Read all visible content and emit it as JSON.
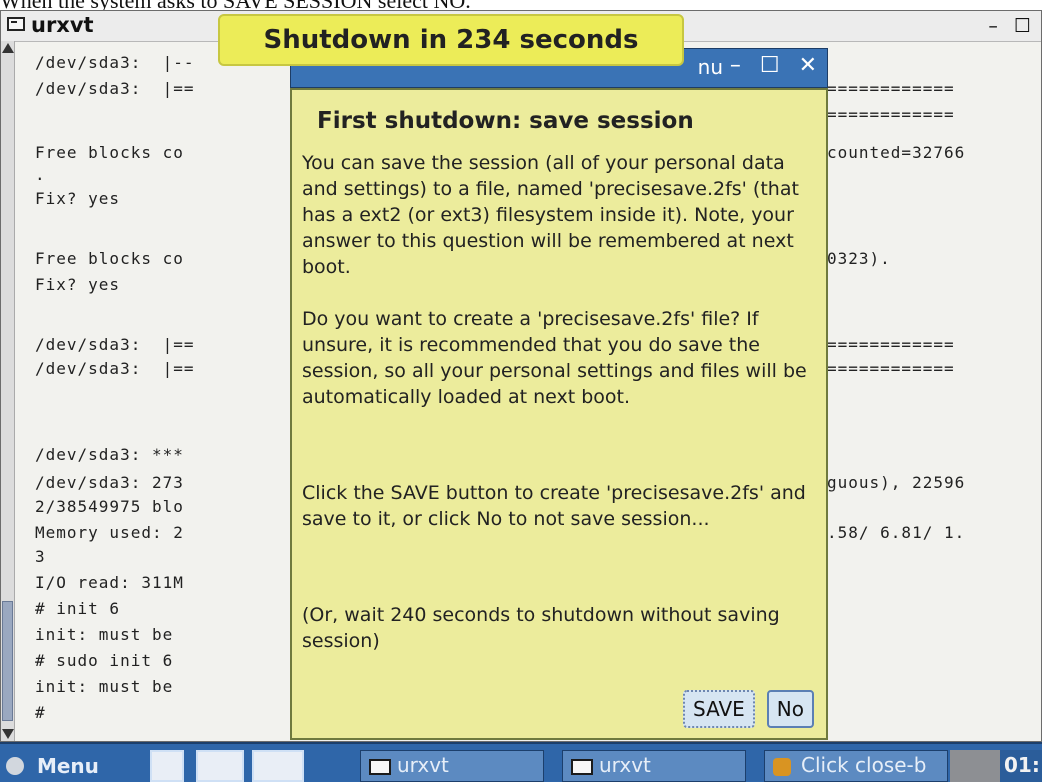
{
  "caption": "When the system asks to SAVE SESSION select NO.",
  "terminal": {
    "title": "urxvt",
    "controls": {
      "minimize": "–",
      "maximize": "☐"
    },
    "lines": [
      "/dev/sda3:  |--",
      "/dev/sda3:  |==",
      "",
      "Free blocks co",
      ".",
      "Fix? yes",
      "",
      "Free blocks co",
      "Fix? yes",
      "",
      "/dev/sda3:  |==",
      "/dev/sda3:  |==",
      "",
      "",
      "/dev/sda3: ***",
      "/dev/sda3: 273",
      "2/38549975 blo",
      "Memory used: 2",
      "3",
      "I/O read: 311M",
      "# init 6",
      "init: must be",
      "# sudo init 6",
      "init: must be",
      "#"
    ],
    "right_fragments": [
      "============",
      "============",
      "",
      "counted=32766",
      "",
      "",
      "",
      "0323).",
      "",
      "",
      "============",
      "============",
      "",
      "",
      "",
      "guous), 22596",
      "",
      ".58/ 6.81/ 1.",
      "",
      "",
      "",
      "",
      "",
      "",
      ""
    ]
  },
  "countdown": "Shutdown in 234 seconds",
  "dialog": {
    "titlebar": {
      "title_fragment": "nu",
      "controls": {
        "minimize": "–",
        "maximize": "☐",
        "close": "✕"
      }
    },
    "heading": "First shutdown: save session",
    "paragraphs": [
      "You can save the session (all of your personal data and settings) to a file, named 'precisesave.2fs' (that has a ext2 (or ext3) filesystem inside it). Note, your answer to this question will be remembered at next boot.",
      "Do you want to create a 'precisesave.2fs' file? If unsure, it is recommended that you do save the session, so all your personal settings and files will be automatically loaded at next boot.",
      "Click the SAVE button to create 'precisesave.2fs' and save to it, or click No to not save session...",
      "(Or, wait 240 seconds to shutdown without saving session)"
    ],
    "buttons": {
      "save": "SAVE",
      "no": "No"
    }
  },
  "taskbar": {
    "menu_label": "Menu",
    "tasks": [
      {
        "label": "urxvt"
      },
      {
        "label": "urxvt"
      },
      {
        "label": "Click close-b"
      }
    ],
    "clock": "01:"
  }
}
